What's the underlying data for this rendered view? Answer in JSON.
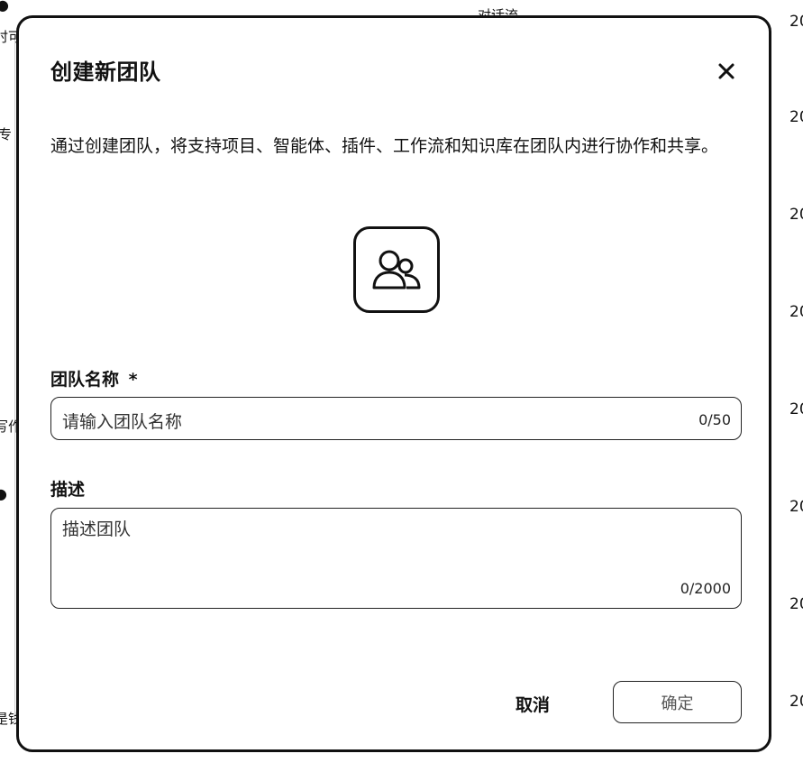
{
  "background": {
    "left_fragments": [
      "时可",
      "专",
      "写作",
      "是钱"
    ],
    "top_fragment": "对话流",
    "year_stubs": [
      "20",
      "20",
      "20",
      "20",
      "20",
      "20",
      "20",
      "20"
    ]
  },
  "modal": {
    "title": "创建新团队",
    "description": "通过创建团队，将支持项目、智能体、插件、工作流和知识库在团队内进行协作和共享。",
    "avatar_icon": "team-users-icon",
    "name_field": {
      "label": "团队名称",
      "required_mark": "*",
      "placeholder": "请输入团队名称",
      "counter": "0/50"
    },
    "description_field": {
      "label": "描述",
      "placeholder": "描述团队",
      "counter": "0/2000"
    },
    "buttons": {
      "cancel": "取消",
      "confirm": "确定"
    }
  }
}
